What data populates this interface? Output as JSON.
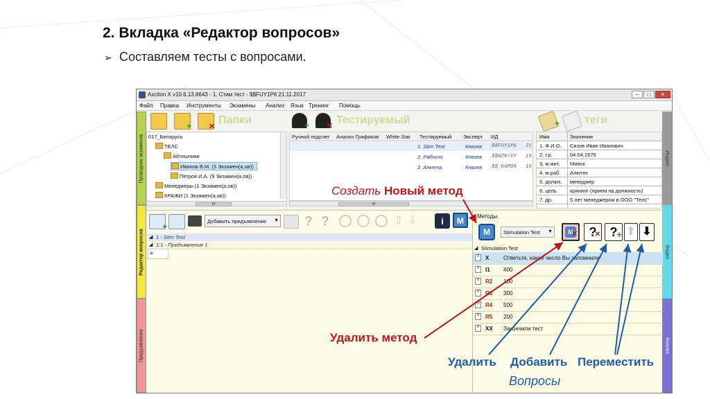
{
  "slide": {
    "title": "2. Вкладка «Редактор вопросов»",
    "bullet_mark": "➢",
    "bullet_text": "Составляем тесты с вопросами."
  },
  "window": {
    "title": "Axciton X v10.6.13.8643 - 1. Стим тест - $$FUY1P6 21.11.2017",
    "controls": [
      "–",
      "□",
      "✕"
    ]
  },
  "menu": [
    "Файл",
    "Правка",
    "Инструменты",
    "Экзамены",
    "Анализ",
    "Язык",
    "Тренинг",
    "Помощь"
  ],
  "left_tabs": {
    "explorer": "Проводник экзаменов",
    "editor": "Редактор вопросов",
    "pre": "Предъявление"
  },
  "right_tabs": {
    "index": "Индекс",
    "video": "Видео",
    "analysis": "Анализ"
  },
  "top": {
    "folders_title": "Папки",
    "tested_title": "Тестируемый",
    "tags_title": "теги",
    "tree": [
      {
        "text": "017_Беларусь",
        "level": 0,
        "folder": false
      },
      {
        "text": "ТЕЛС",
        "level": 1,
        "folder": true
      },
      {
        "text": "Айтишники",
        "level": 2,
        "folder": true
      },
      {
        "text": "Иванов В.М. (3 Экзамен(а,ов))",
        "level": 3,
        "folder": true,
        "selected": true
      },
      {
        "text": "Петров И.А. (9 Экзамен(а,ов))",
        "level": 3,
        "folder": true
      },
      {
        "text": "Менеджеры (1 Экзамен(а,ов))",
        "level": 1,
        "folder": true
      },
      {
        "text": "КРАЖИ (1 Экзамен(а,ов))",
        "level": 1,
        "folder": true
      }
    ],
    "exam_columns": [
      "Ручной подсчет",
      "Анализ Графиков",
      "White Star",
      "Тестируемый",
      "Эксперт",
      "ИД"
    ],
    "exam_rows": [
      {
        "name": "1. Stim Test",
        "expert": "Князев",
        "id": "$$FUY1P6",
        "num": "21"
      },
      {
        "name": "2. Работа",
        "expert": "Князев",
        "id": "$$NZK!VY",
        "num": "16"
      },
      {
        "name": "2. Анкета",
        "expert": "Князев",
        "id": "$$_KAM5%",
        "num": "16"
      }
    ],
    "tag_columns": [
      "Имя",
      "Значение"
    ],
    "tags": [
      {
        "name": "1. Ф.И.О.",
        "value": "Сизов Иван Иванович"
      },
      {
        "name": "2. г.р.",
        "value": "04.04.1979"
      },
      {
        "name": "3. м.жит.",
        "value": "Минск"
      },
      {
        "name": "4. м.раб.",
        "value": "Алютех"
      },
      {
        "name": "5. должн.",
        "value": "менеджер"
      },
      {
        "name": "6. цель",
        "value": "крининг (прием на должность)"
      },
      {
        "name": "7. др.",
        "value": "5 лет менеджером в ООО \"Телс\""
      }
    ]
  },
  "bottom": {
    "present_dropdown": "Добавить предъявление",
    "tree_rows": [
      "1 - Stim Test",
      "1:1 - Предъявление 1"
    ],
    "methods_label": "Методы",
    "method_select": "Stimulation Test",
    "test_name": "Stimulation Test",
    "questions": [
      {
        "code": "X",
        "text": "Ответьте, какое число Вы запомнили",
        "color": "#111111"
      },
      {
        "code": "I1",
        "text": "400",
        "color": "#111111"
      },
      {
        "code": "R2",
        "text": "100",
        "color": "#b3261e"
      },
      {
        "code": "R3",
        "text": "300",
        "color": "#b3261e"
      },
      {
        "code": "R4",
        "text": "500",
        "color": "#b3261e"
      },
      {
        "code": "R5",
        "text": "200",
        "color": "#b3261e"
      },
      {
        "code": "XX",
        "text": "Закончили тест",
        "color": "#111111"
      }
    ]
  },
  "annotations": {
    "create_italic": "Создать",
    "create_bold": "Новый метод",
    "delete_method": "Удалить метод",
    "delete": "Удалить",
    "add": "Добавить",
    "move": "Переместить",
    "questions": "Вопросы",
    "red": "#c0151b",
    "blue": "#1f5ca8"
  }
}
